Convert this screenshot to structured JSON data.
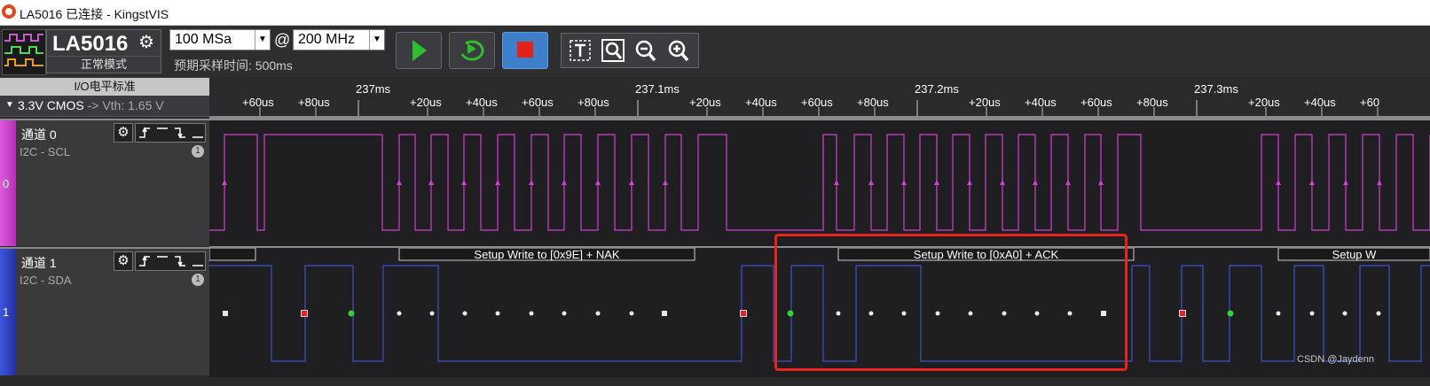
{
  "window": {
    "title": "LA5016 已连接 - KingstVIS"
  },
  "device": {
    "name": "LA5016",
    "mode": "正常模式"
  },
  "controls": {
    "sample_rate": "100 MSa",
    "at_sign": "@",
    "frequency": "200 MHz",
    "estimated_time": "预期采样时间: 500ms"
  },
  "io_standard": {
    "title": "I/O电平标准",
    "level": "3.3V CMOS",
    "threshold": "-> Vth: 1.65 V"
  },
  "ruler": {
    "major": [
      "237ms",
      "237.1ms",
      "237.2ms",
      "237.3ms"
    ],
    "minor": [
      "+60us",
      "+80us",
      "+20us",
      "+40us",
      "+60us",
      "+80us",
      "+20us",
      "+40us",
      "+60us",
      "+80us",
      "+20us",
      "+40us",
      "+60us",
      "+80us",
      "+20us",
      "+40us",
      "+60"
    ]
  },
  "channels": [
    {
      "number": "0",
      "label": "通道 0",
      "protocol": "I2C - SCL",
      "badge": "1",
      "color": "#d23fd2"
    },
    {
      "number": "1",
      "label": "通道 1",
      "protocol": "I2C - SDA",
      "badge": "1",
      "color": "#3b4fd2"
    }
  ],
  "decodes": [
    {
      "text": "Setup Write to [0x9E] + NAK"
    },
    {
      "text": "Setup Write to [0xA0] + ACK"
    },
    {
      "text": "Setup W"
    }
  ],
  "highlight_color": "#e8231c",
  "watermark": "CSDN @Jaydenn"
}
